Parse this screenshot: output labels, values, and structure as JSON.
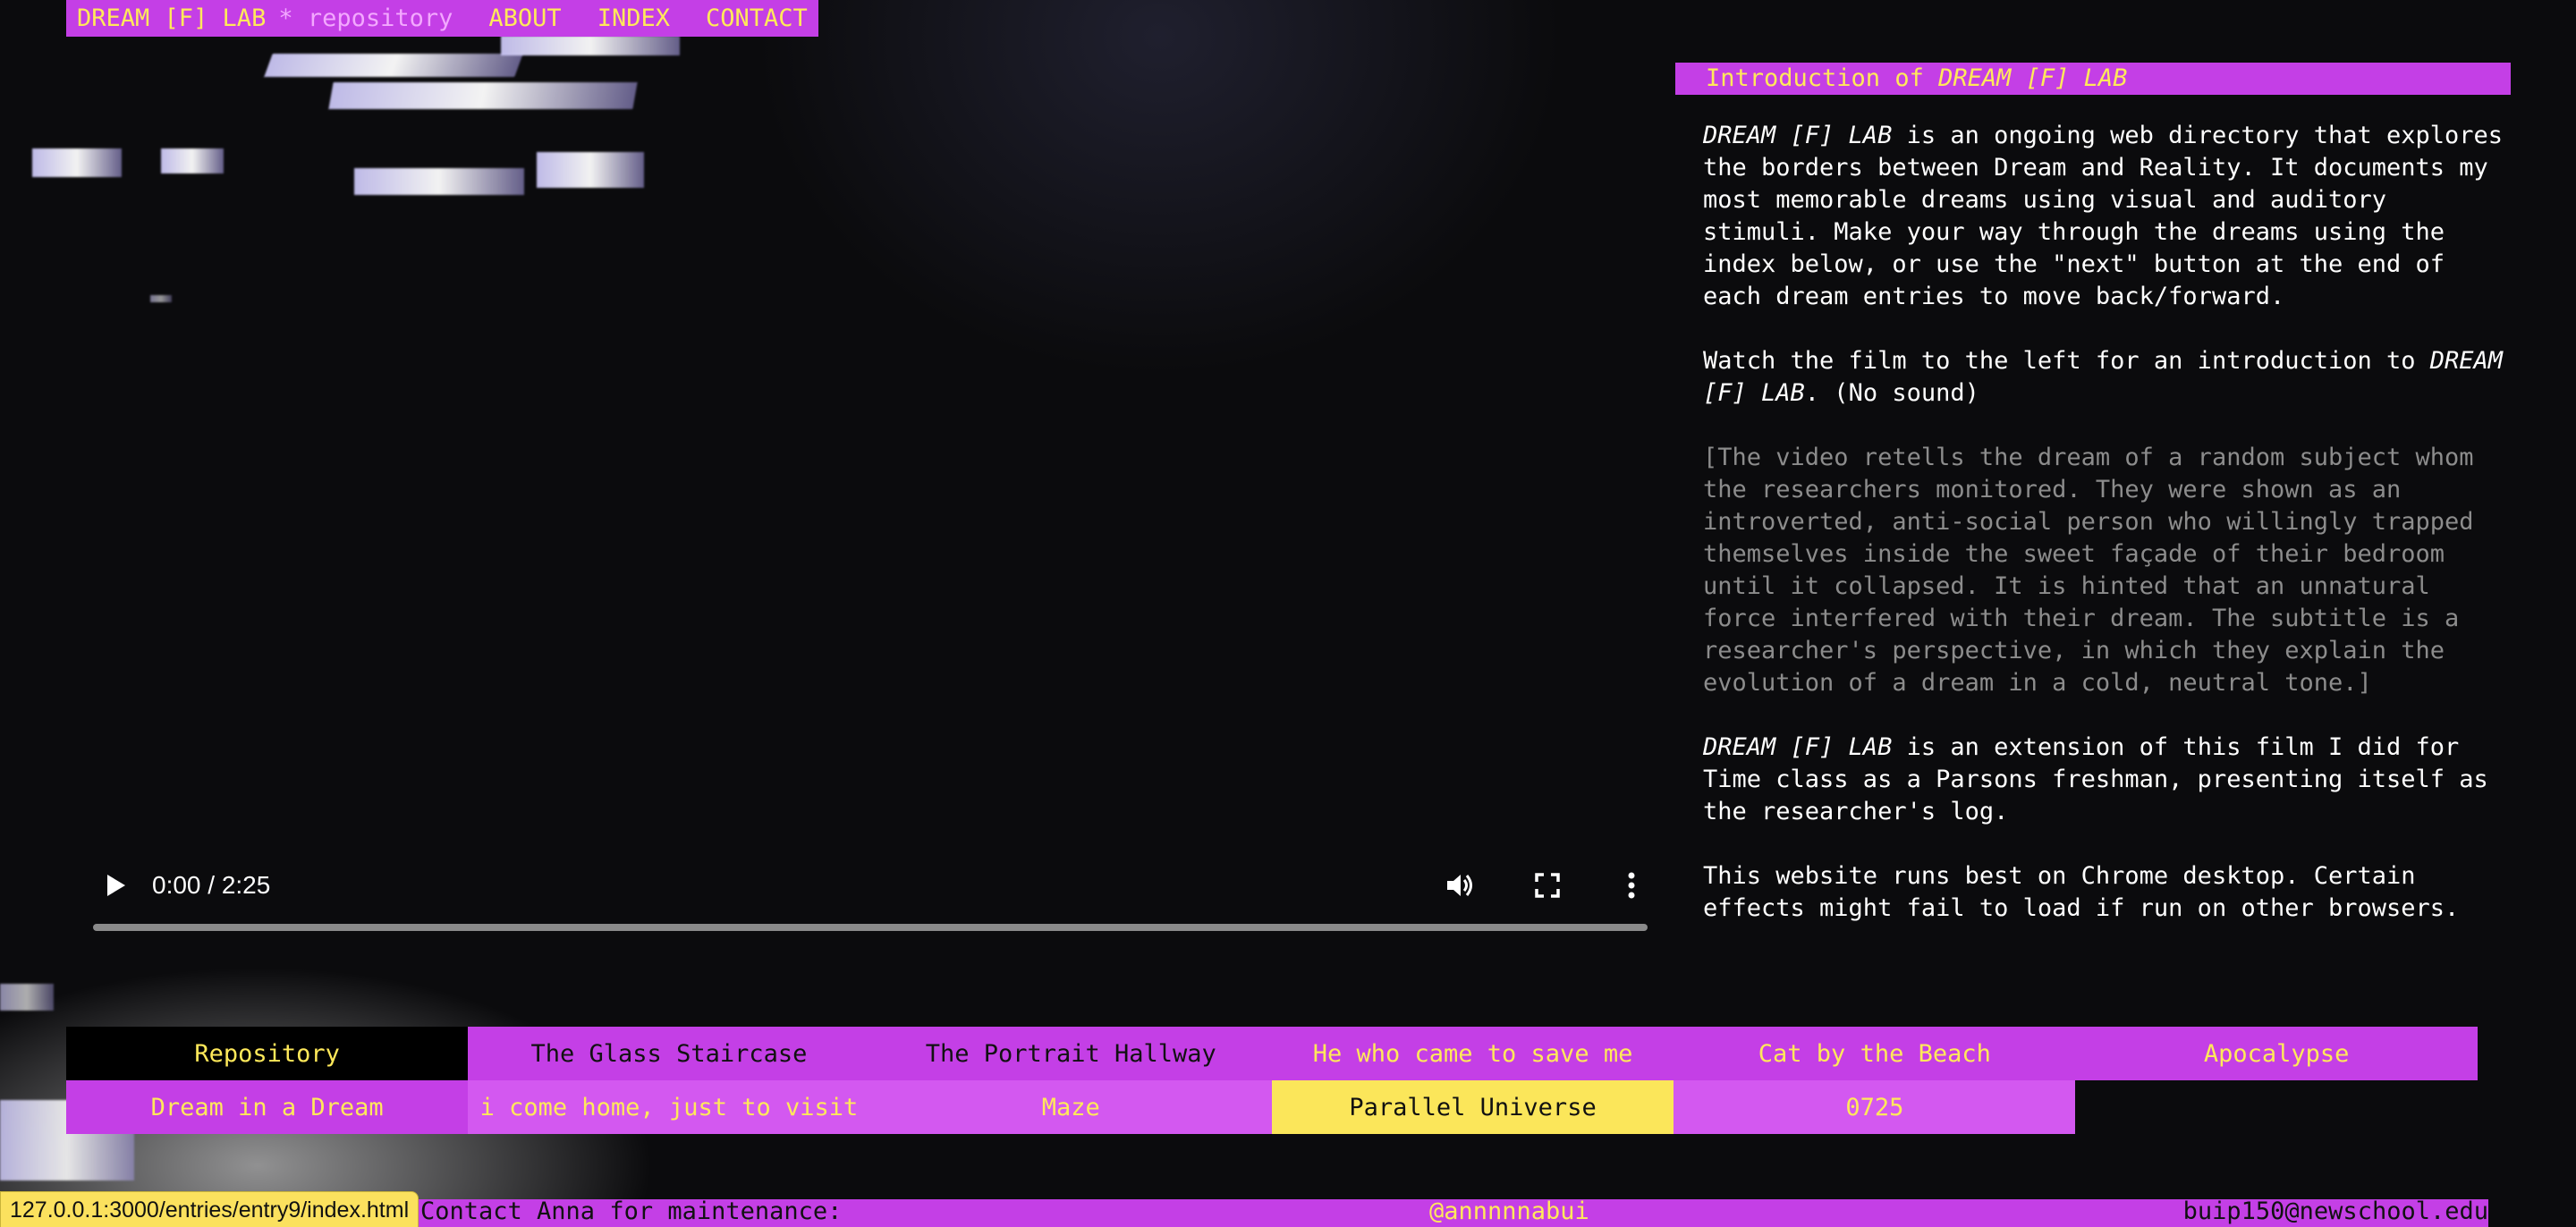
{
  "nav": {
    "brand": "DREAM [F] LAB",
    "sub": "* repository",
    "links": [
      "ABOUT",
      "INDEX",
      "CONTACT"
    ]
  },
  "video": {
    "time": "0:00 / 2:25",
    "progress": 0,
    "icons": [
      "play-icon",
      "volume-icon",
      "fullscreen-icon",
      "more-vert-icon"
    ]
  },
  "intro": {
    "header_prefix": "Introduction of ",
    "header_em": "DREAM [F] LAB",
    "p1_em": "DREAM [F] LAB",
    "p1_rest": " is an ongoing web directory that explores the borders between Dream and Reality. It documents my most memorable dreams using visual and auditory stimuli. Make your way through the dreams using the index below, or use the \"next\" button at the end of each dream entries to move back/forward.",
    "p2_start": "Watch the film to the left for an introduction to ",
    "p2_em": "DREAM [F] LAB",
    "p2_end": ". (No sound)",
    "p3": "[The video retells the dream of a random subject whom the researchers monitored. They were shown as an introverted, anti-social person who willingly trapped themselves inside the sweet façade of their bedroom until it collapsed. It is hinted that an unnatural force interfered with their dream. The subtitle is a researcher's perspective, in which they explain the evolution of a dream in a cold, neutral tone.]",
    "p4_em": "DREAM [F] LAB",
    "p4_rest": " is an extension of this film I did for Time class as a Parsons freshman, presenting itself as the researcher's log.",
    "p5": "This website runs best on Chrome desktop. Certain effects might fail to load if run on other browsers."
  },
  "index": {
    "row1": [
      "Repository",
      "The Glass Staircase",
      "The Portrait Hallway",
      "He who came to save me",
      "Cat by the Beach",
      "Apocalypse"
    ],
    "row2": [
      "Dream in a Dream",
      "i come home, just to visit",
      "Maze",
      "Parallel Universe",
      "0725"
    ]
  },
  "footer": {
    "left": "Contact Anna for maintenance:",
    "mid": "@annnnnabui",
    "right": "buip150@newschool.edu"
  },
  "status_url": "127.0.0.1:3000/entries/entry9/index.html",
  "colors": {
    "magenta": "#c43fe6",
    "yellow": "#ffe95a",
    "black": "#000000"
  }
}
